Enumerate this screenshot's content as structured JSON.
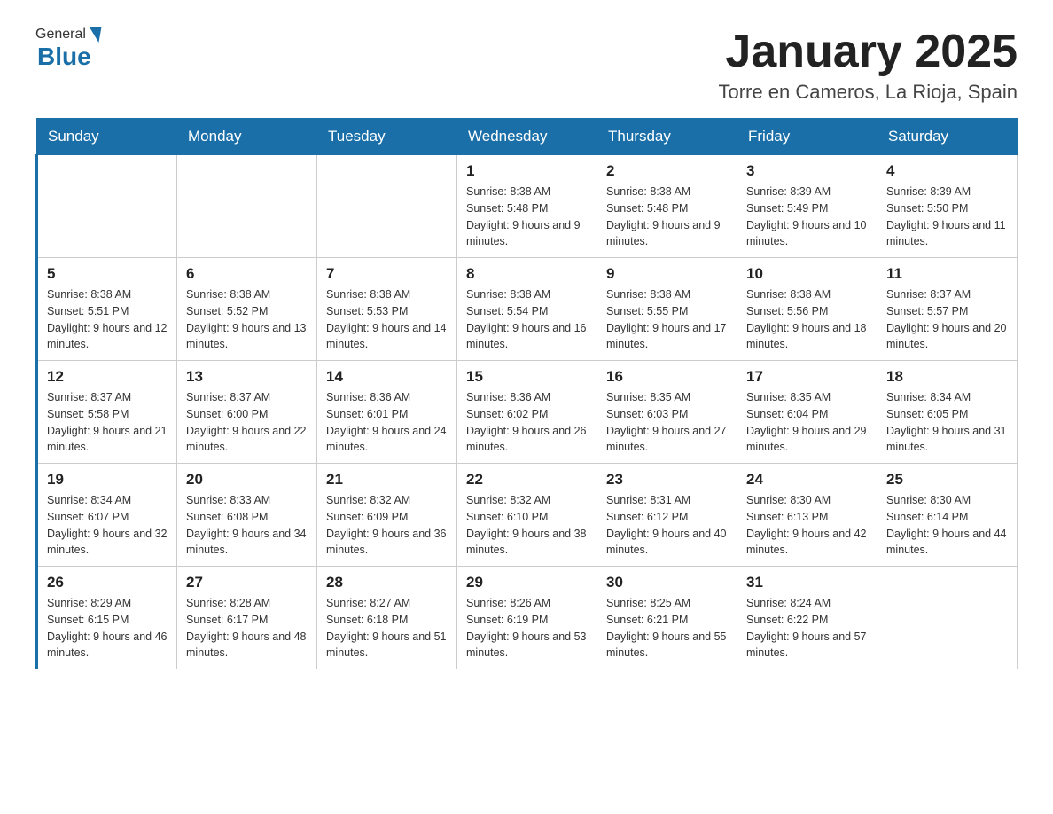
{
  "header": {
    "logo": {
      "general": "General",
      "blue": "Blue"
    },
    "title": "January 2025",
    "location": "Torre en Cameros, La Rioja, Spain"
  },
  "calendar": {
    "days": [
      "Sunday",
      "Monday",
      "Tuesday",
      "Wednesday",
      "Thursday",
      "Friday",
      "Saturday"
    ],
    "weeks": [
      [
        {
          "day": "",
          "info": ""
        },
        {
          "day": "",
          "info": ""
        },
        {
          "day": "",
          "info": ""
        },
        {
          "day": "1",
          "info": "Sunrise: 8:38 AM\nSunset: 5:48 PM\nDaylight: 9 hours and 9 minutes."
        },
        {
          "day": "2",
          "info": "Sunrise: 8:38 AM\nSunset: 5:48 PM\nDaylight: 9 hours and 9 minutes."
        },
        {
          "day": "3",
          "info": "Sunrise: 8:39 AM\nSunset: 5:49 PM\nDaylight: 9 hours and 10 minutes."
        },
        {
          "day": "4",
          "info": "Sunrise: 8:39 AM\nSunset: 5:50 PM\nDaylight: 9 hours and 11 minutes."
        }
      ],
      [
        {
          "day": "5",
          "info": "Sunrise: 8:38 AM\nSunset: 5:51 PM\nDaylight: 9 hours and 12 minutes."
        },
        {
          "day": "6",
          "info": "Sunrise: 8:38 AM\nSunset: 5:52 PM\nDaylight: 9 hours and 13 minutes."
        },
        {
          "day": "7",
          "info": "Sunrise: 8:38 AM\nSunset: 5:53 PM\nDaylight: 9 hours and 14 minutes."
        },
        {
          "day": "8",
          "info": "Sunrise: 8:38 AM\nSunset: 5:54 PM\nDaylight: 9 hours and 16 minutes."
        },
        {
          "day": "9",
          "info": "Sunrise: 8:38 AM\nSunset: 5:55 PM\nDaylight: 9 hours and 17 minutes."
        },
        {
          "day": "10",
          "info": "Sunrise: 8:38 AM\nSunset: 5:56 PM\nDaylight: 9 hours and 18 minutes."
        },
        {
          "day": "11",
          "info": "Sunrise: 8:37 AM\nSunset: 5:57 PM\nDaylight: 9 hours and 20 minutes."
        }
      ],
      [
        {
          "day": "12",
          "info": "Sunrise: 8:37 AM\nSunset: 5:58 PM\nDaylight: 9 hours and 21 minutes."
        },
        {
          "day": "13",
          "info": "Sunrise: 8:37 AM\nSunset: 6:00 PM\nDaylight: 9 hours and 22 minutes."
        },
        {
          "day": "14",
          "info": "Sunrise: 8:36 AM\nSunset: 6:01 PM\nDaylight: 9 hours and 24 minutes."
        },
        {
          "day": "15",
          "info": "Sunrise: 8:36 AM\nSunset: 6:02 PM\nDaylight: 9 hours and 26 minutes."
        },
        {
          "day": "16",
          "info": "Sunrise: 8:35 AM\nSunset: 6:03 PM\nDaylight: 9 hours and 27 minutes."
        },
        {
          "day": "17",
          "info": "Sunrise: 8:35 AM\nSunset: 6:04 PM\nDaylight: 9 hours and 29 minutes."
        },
        {
          "day": "18",
          "info": "Sunrise: 8:34 AM\nSunset: 6:05 PM\nDaylight: 9 hours and 31 minutes."
        }
      ],
      [
        {
          "day": "19",
          "info": "Sunrise: 8:34 AM\nSunset: 6:07 PM\nDaylight: 9 hours and 32 minutes."
        },
        {
          "day": "20",
          "info": "Sunrise: 8:33 AM\nSunset: 6:08 PM\nDaylight: 9 hours and 34 minutes."
        },
        {
          "day": "21",
          "info": "Sunrise: 8:32 AM\nSunset: 6:09 PM\nDaylight: 9 hours and 36 minutes."
        },
        {
          "day": "22",
          "info": "Sunrise: 8:32 AM\nSunset: 6:10 PM\nDaylight: 9 hours and 38 minutes."
        },
        {
          "day": "23",
          "info": "Sunrise: 8:31 AM\nSunset: 6:12 PM\nDaylight: 9 hours and 40 minutes."
        },
        {
          "day": "24",
          "info": "Sunrise: 8:30 AM\nSunset: 6:13 PM\nDaylight: 9 hours and 42 minutes."
        },
        {
          "day": "25",
          "info": "Sunrise: 8:30 AM\nSunset: 6:14 PM\nDaylight: 9 hours and 44 minutes."
        }
      ],
      [
        {
          "day": "26",
          "info": "Sunrise: 8:29 AM\nSunset: 6:15 PM\nDaylight: 9 hours and 46 minutes."
        },
        {
          "day": "27",
          "info": "Sunrise: 8:28 AM\nSunset: 6:17 PM\nDaylight: 9 hours and 48 minutes."
        },
        {
          "day": "28",
          "info": "Sunrise: 8:27 AM\nSunset: 6:18 PM\nDaylight: 9 hours and 51 minutes."
        },
        {
          "day": "29",
          "info": "Sunrise: 8:26 AM\nSunset: 6:19 PM\nDaylight: 9 hours and 53 minutes."
        },
        {
          "day": "30",
          "info": "Sunrise: 8:25 AM\nSunset: 6:21 PM\nDaylight: 9 hours and 55 minutes."
        },
        {
          "day": "31",
          "info": "Sunrise: 8:24 AM\nSunset: 6:22 PM\nDaylight: 9 hours and 57 minutes."
        },
        {
          "day": "",
          "info": ""
        }
      ]
    ]
  }
}
